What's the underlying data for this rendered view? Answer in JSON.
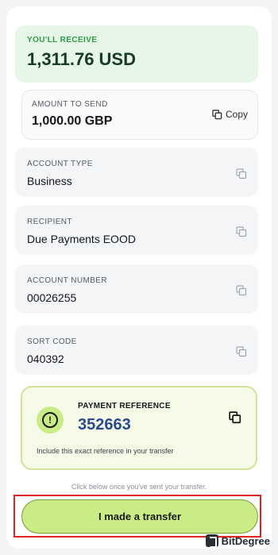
{
  "receive": {
    "label": "YOU'LL RECEIVE",
    "amount": "1,311.76 USD"
  },
  "amount_to_send": {
    "label": "AMOUNT TO SEND",
    "value": "1,000.00 GBP",
    "copy_label": "Copy"
  },
  "fields": [
    {
      "label": "ACCOUNT TYPE",
      "value": "Business"
    },
    {
      "label": "RECIPIENT",
      "value": "Due Payments EOOD"
    },
    {
      "label": "ACCOUNT NUMBER",
      "value": "00026255"
    },
    {
      "label": "SORT CODE",
      "value": "040392"
    }
  ],
  "payment_reference": {
    "label": "PAYMENT REFERENCE",
    "value": "352663",
    "hint": "Include this exact reference in your transfer"
  },
  "note": "Click below once you've sent your transfer.",
  "cta_label": "I made a transfer",
  "watermark": "BitDegree",
  "colors": {
    "accent_green": "#c9ec86",
    "receive_bg": "#e6f6e8",
    "highlight_red": "#e02424",
    "ref_blue": "#2a4a8c"
  }
}
